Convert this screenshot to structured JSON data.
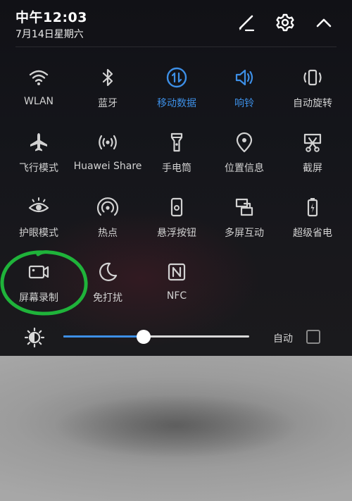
{
  "status": {
    "time": "中午12:03",
    "date": "7月14日星期六"
  },
  "header_actions": [
    {
      "name": "edit-icon"
    },
    {
      "name": "gear-icon"
    },
    {
      "name": "chevron-up-icon"
    }
  ],
  "tiles": [
    {
      "label": "WLAN",
      "icon": "wifi-icon",
      "active": false
    },
    {
      "label": "蓝牙",
      "icon": "bluetooth-icon",
      "active": false
    },
    {
      "label": "移动数据",
      "icon": "mobile-data-icon",
      "active": true
    },
    {
      "label": "响铃",
      "icon": "volume-icon",
      "active": true
    },
    {
      "label": "自动旋转",
      "icon": "auto-rotate-icon",
      "active": false
    },
    {
      "label": "飞行模式",
      "icon": "airplane-icon",
      "active": false
    },
    {
      "label": "Huawei Share",
      "icon": "huawei-share-icon",
      "active": false
    },
    {
      "label": "手电筒",
      "icon": "flashlight-icon",
      "active": false
    },
    {
      "label": "位置信息",
      "icon": "location-icon",
      "active": false
    },
    {
      "label": "截屏",
      "icon": "screenshot-icon",
      "active": false
    },
    {
      "label": "护眼模式",
      "icon": "eye-icon",
      "active": false
    },
    {
      "label": "热点",
      "icon": "hotspot-icon",
      "active": false
    },
    {
      "label": "悬浮按钮",
      "icon": "floating-button-icon",
      "active": false
    },
    {
      "label": "多屏互动",
      "icon": "multi-screen-icon",
      "active": false
    },
    {
      "label": "超级省电",
      "icon": "battery-saver-icon",
      "active": false
    },
    {
      "label": "屏幕录制",
      "icon": "screen-record-icon",
      "active": false
    },
    {
      "label": "免打扰",
      "icon": "moon-icon",
      "active": false
    },
    {
      "label": "NFC",
      "icon": "nfc-icon",
      "active": false
    }
  ],
  "brightness": {
    "level": 0.43,
    "auto_label": "自动",
    "auto_checked": false
  },
  "colors": {
    "accent": "#3d8fe6",
    "highlight_circle": "#1fb33a"
  }
}
